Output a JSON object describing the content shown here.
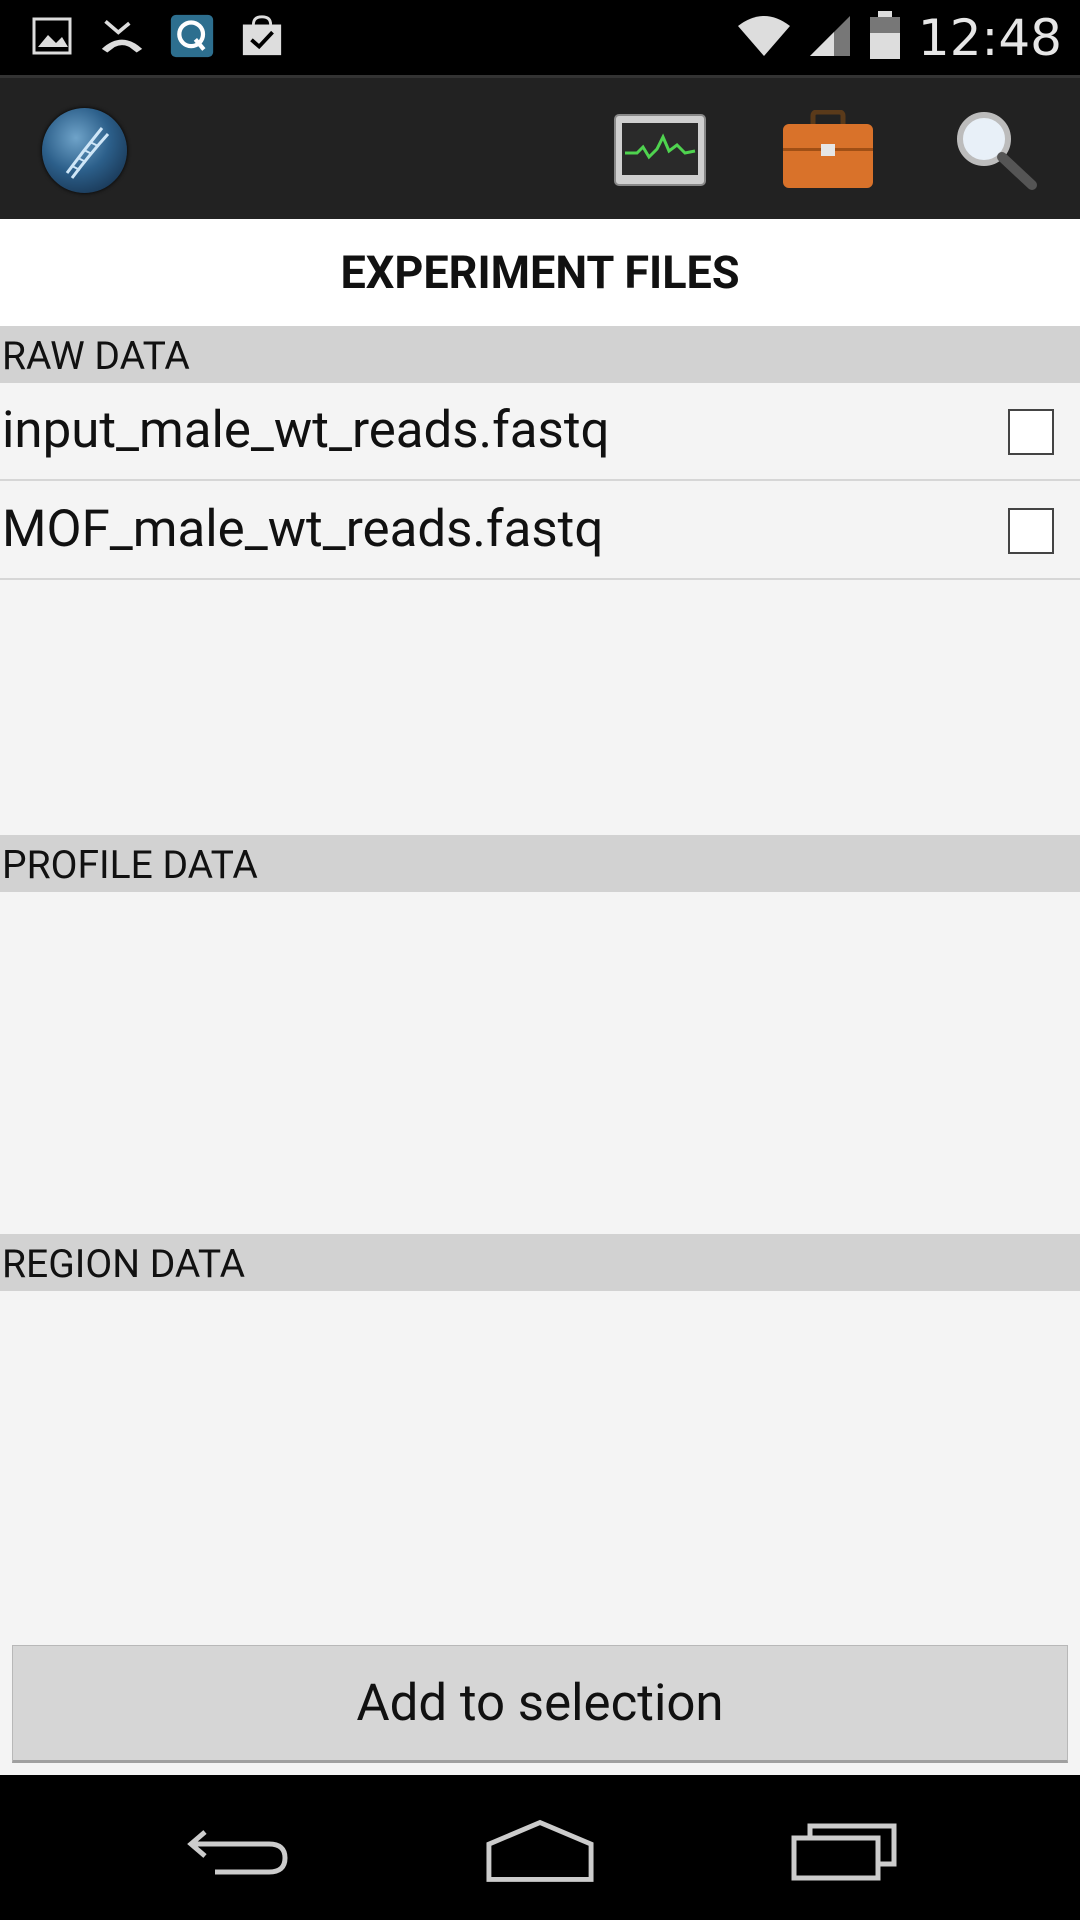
{
  "status_bar": {
    "time": "12:48",
    "icons": [
      "image-icon",
      "missed-call-icon",
      "q-app-icon",
      "shopping-bag-check-icon",
      "wifi-icon",
      "signal-icon",
      "battery-icon"
    ]
  },
  "action_bar": {
    "icons": [
      "dna-globe-logo-icon",
      "monitor-chart-icon",
      "briefcase-icon",
      "search-icon"
    ]
  },
  "page": {
    "title": "EXPERIMENT FILES"
  },
  "sections": {
    "raw": {
      "label": "RAW DATA",
      "files": [
        "input_male_wt_reads.fastq",
        "MOF_male_wt_reads.fastq"
      ]
    },
    "profile": {
      "label": "PROFILE DATA"
    },
    "region": {
      "label": "REGION DATA"
    }
  },
  "actions": {
    "add_label": "Add to selection"
  },
  "colors": {
    "accent_orange": "#d9722a",
    "header_bg": "#d2d2d2"
  }
}
